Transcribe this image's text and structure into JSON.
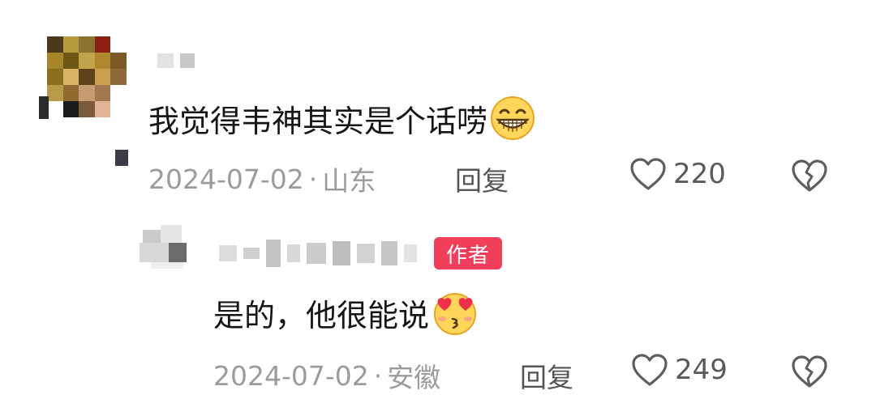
{
  "comment": {
    "text": "我觉得韦神其实是个话唠",
    "emoji": "grinning-face-icon",
    "date": "2024-07-02",
    "location": "山东",
    "reply_label": "回复",
    "likes": "220"
  },
  "reply": {
    "badge": "作者",
    "text": "是的，他很能说",
    "emoji": "face-blowing-kiss-icon",
    "date": "2024-07-02",
    "location": "安徽",
    "reply_label": "回复",
    "likes": "249"
  },
  "colors": {
    "badge": "#f13e5b",
    "meta_text": "#9b9b9b",
    "body_text": "#161616"
  }
}
